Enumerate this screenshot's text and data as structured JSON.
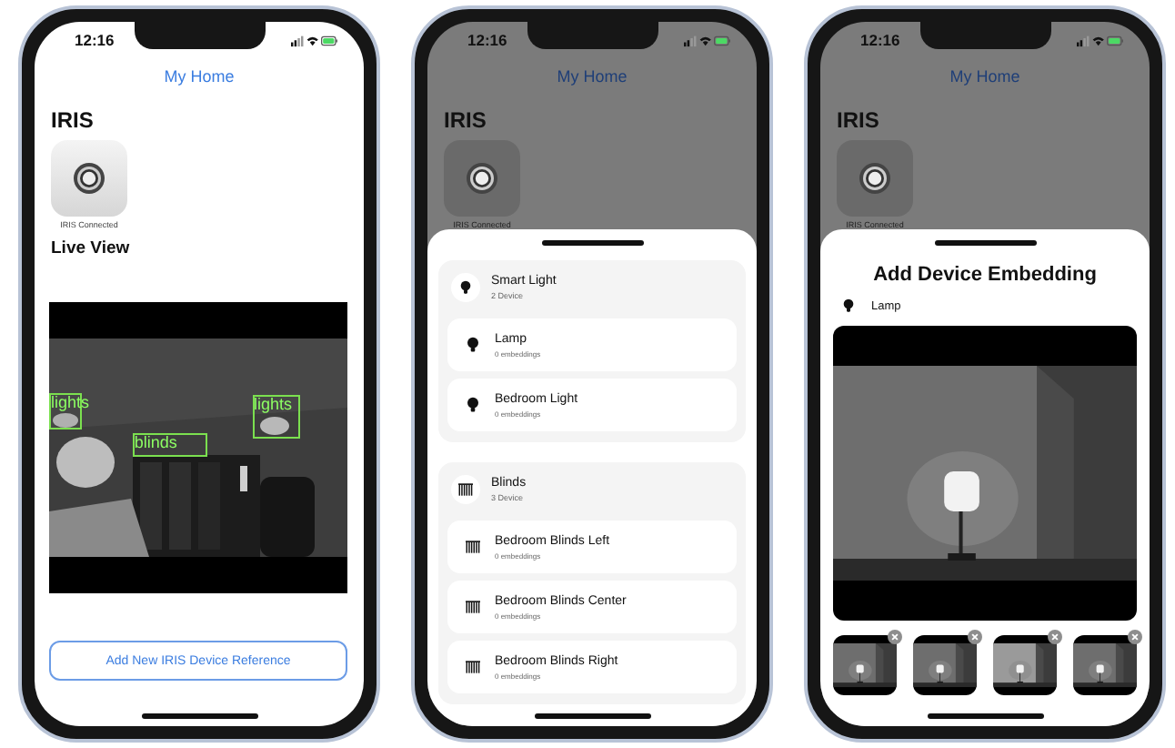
{
  "phones": [
    {
      "kind": "home",
      "dimmed": false,
      "time": "12:16",
      "nav_title": "My Home",
      "heading": "IRIS",
      "device_caption": "IRIS Connected",
      "section": "Live View",
      "detections": [
        {
          "label": "lights"
        },
        {
          "label": "lights"
        },
        {
          "label": "blinds"
        }
      ],
      "button": "Add New IRIS Device Reference"
    },
    {
      "kind": "device_list",
      "dimmed": true,
      "time": "12:16",
      "nav_title": "My Home",
      "heading": "IRIS",
      "device_caption": "IRIS Connected",
      "groups": [
        {
          "kind": "bulb",
          "name": "Smart Light",
          "count": "2 Device",
          "devices": [
            {
              "name": "Lamp",
              "detail": "0 embeddings"
            },
            {
              "name": "Bedroom Light",
              "detail": "0 embeddings"
            }
          ]
        },
        {
          "kind": "blinds",
          "name": "Blinds",
          "count": "3 Device",
          "devices": [
            {
              "name": "Bedroom Blinds Left",
              "detail": "0 embeddings"
            },
            {
              "name": "Bedroom Blinds Center",
              "detail": "0 embeddings"
            },
            {
              "name": "Bedroom Blinds Right",
              "detail": "0 embeddings"
            }
          ]
        }
      ]
    },
    {
      "kind": "embedding",
      "dimmed": true,
      "time": "12:16",
      "nav_title": "My Home",
      "heading": "IRIS",
      "device_caption": "IRIS Connected",
      "sheet_title": "Add Device Embedding",
      "device_name": "Lamp"
    }
  ]
}
